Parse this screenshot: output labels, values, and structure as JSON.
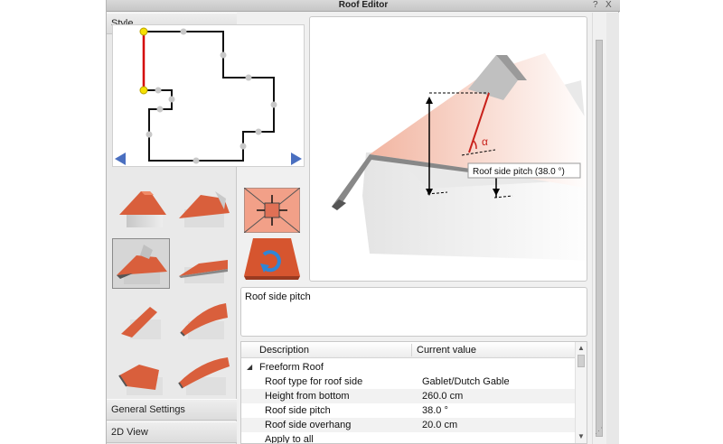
{
  "window": {
    "title": "Roof Editor",
    "help_label": "?",
    "close_label": "X"
  },
  "sections": {
    "style": "Style",
    "general": "General Settings",
    "view2d": "2D View"
  },
  "preview": {
    "tooltip": "Roof side pitch (38.0 °)",
    "alpha": "α"
  },
  "description": "Roof side pitch",
  "grid": {
    "col_description": "Description",
    "col_value": "Current value",
    "group": "Freeform Roof",
    "rows": [
      {
        "label": "Roof type for roof side",
        "value": "Gablet/Dutch Gable"
      },
      {
        "label": "Height from bottom",
        "value": "260.0 cm"
      },
      {
        "label": "Roof side pitch",
        "value": "38.0 °"
      },
      {
        "label": "Roof side overhang",
        "value": "20.0 cm"
      },
      {
        "label": "Apply to all",
        "value": ""
      }
    ]
  },
  "colors": {
    "roof": "#e36a45",
    "roof_light": "#f2b9a6",
    "selection": "#d40000",
    "handle": "#f5e000",
    "nav_arrow": "#4a6fc0"
  },
  "icons": [
    "prev-arrow-icon",
    "next-arrow-icon",
    "pan-roof-icon",
    "rotate-roof-icon",
    "collapse-triangle-icon",
    "resize-grip-icon"
  ]
}
